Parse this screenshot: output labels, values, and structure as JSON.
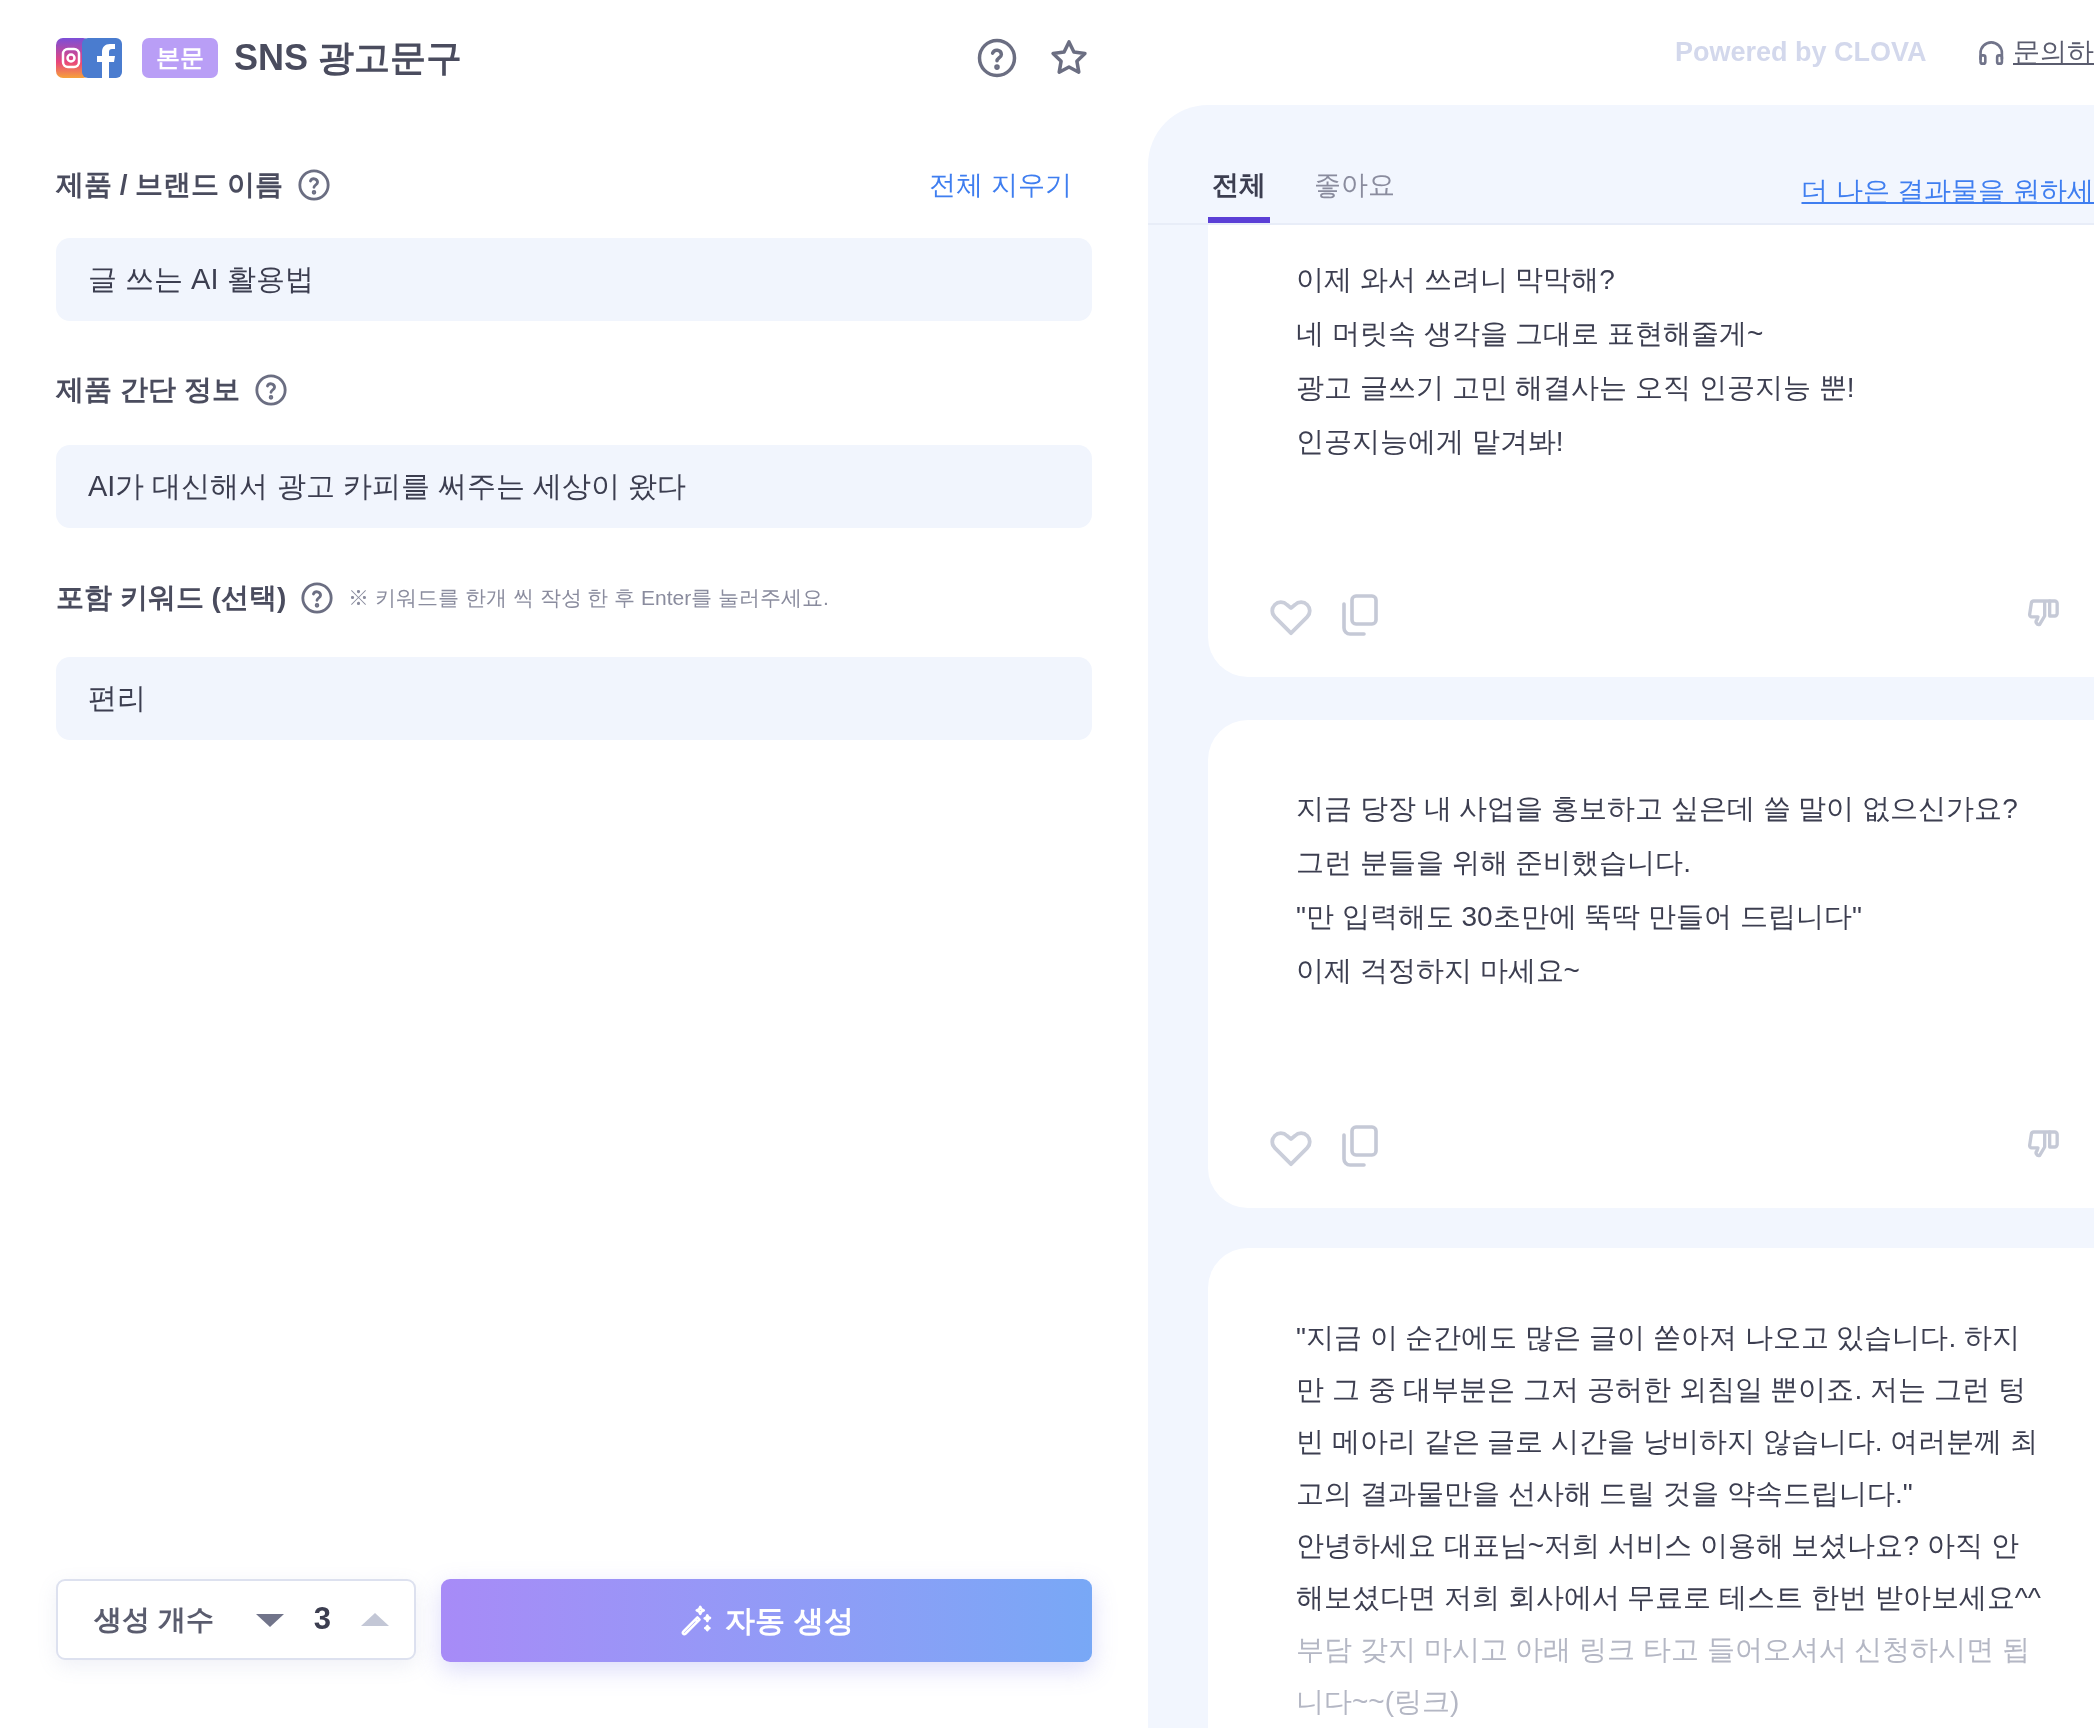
{
  "header": {
    "badge": "본문",
    "title": "SNS 광고문구"
  },
  "form": {
    "clear_all": "전체 지우기",
    "fields": [
      {
        "label": "제품 / 브랜드 이름",
        "value": "글 쓰는 AI 활용법"
      },
      {
        "label": "제품 간단 정보",
        "value": "AI가 대신해서 광고 카피를 써주는 세상이 왔다"
      },
      {
        "label": "포함 키워드 (선택)",
        "hint": "※ 키워드를 한개 씩 작성 한 후 Enter를 눌러주세요.",
        "value": "편리"
      }
    ]
  },
  "stepper": {
    "label": "생성 개수",
    "value": "3",
    "decrease_disabled": false,
    "increase_disabled": true
  },
  "generate_button": "자동 생성",
  "top_bar": {
    "powered_by": "Powered by CLOVA",
    "contact": "문의하"
  },
  "tabs": [
    {
      "label": "전체",
      "selected": true
    },
    {
      "label": "좋아요",
      "selected": false
    }
  ],
  "better_results_link": "더 나은 결과물을 원하세",
  "results": [
    {
      "liked": false,
      "lines": [
        {
          "text": "이제 와서 쓰려니 막막해?",
          "faded": false
        },
        {
          "text": "네 머릿속 생각을 그대로 표현해줄게~",
          "faded": false
        },
        {
          "text": "광고 글쓰기 고민 해결사는 오직 인공지능 뿐!",
          "faded": false
        },
        {
          "text": "인공지능에게 맡겨봐!",
          "faded": false
        }
      ]
    },
    {
      "liked": false,
      "lines": [
        {
          "text": "지금 당장 내 사업을 홍보하고 싶은데 쓸 말이 없으신가요?",
          "faded": false
        },
        {
          "text": "그런 분들을 위해 준비했습니다.",
          "faded": false
        },
        {
          "text": "\"만 입력해도 30초만에 뚝딱 만들어 드립니다\"",
          "faded": false
        },
        {
          "text": "이제 걱정하지 마세요~",
          "faded": false
        }
      ]
    },
    {
      "lines": [
        {
          "text": "\"지금 이 순간에도 많은 글이 쏟아져 나오고 있습니다. 하지",
          "faded": false
        },
        {
          "text": "만 그 중 대부분은 그저 공허한 외침일 뿐이죠. 저는 그런 텅",
          "faded": false
        },
        {
          "text": "빈 메아리 같은 글로 시간을 낭비하지 않습니다. 여러분께 최",
          "faded": false
        },
        {
          "text": "고의 결과물만을 선사해 드릴 것을 약속드립니다.\"",
          "faded": false
        },
        {
          "text": "안녕하세요 대표님~저희 서비스 이용해 보셨나요? 아직 안",
          "faded": false
        },
        {
          "text": "해보셨다면 저희 회사에서 무료로 테스트 한번 받아보세요^^",
          "faded": false
        },
        {
          "text": "부담 갖지 마시고 아래 링크 타고 들어오셔서 신청하시면 됩",
          "faded": true
        },
        {
          "text": "니다~~(링크)",
          "faded": true
        }
      ]
    }
  ]
}
